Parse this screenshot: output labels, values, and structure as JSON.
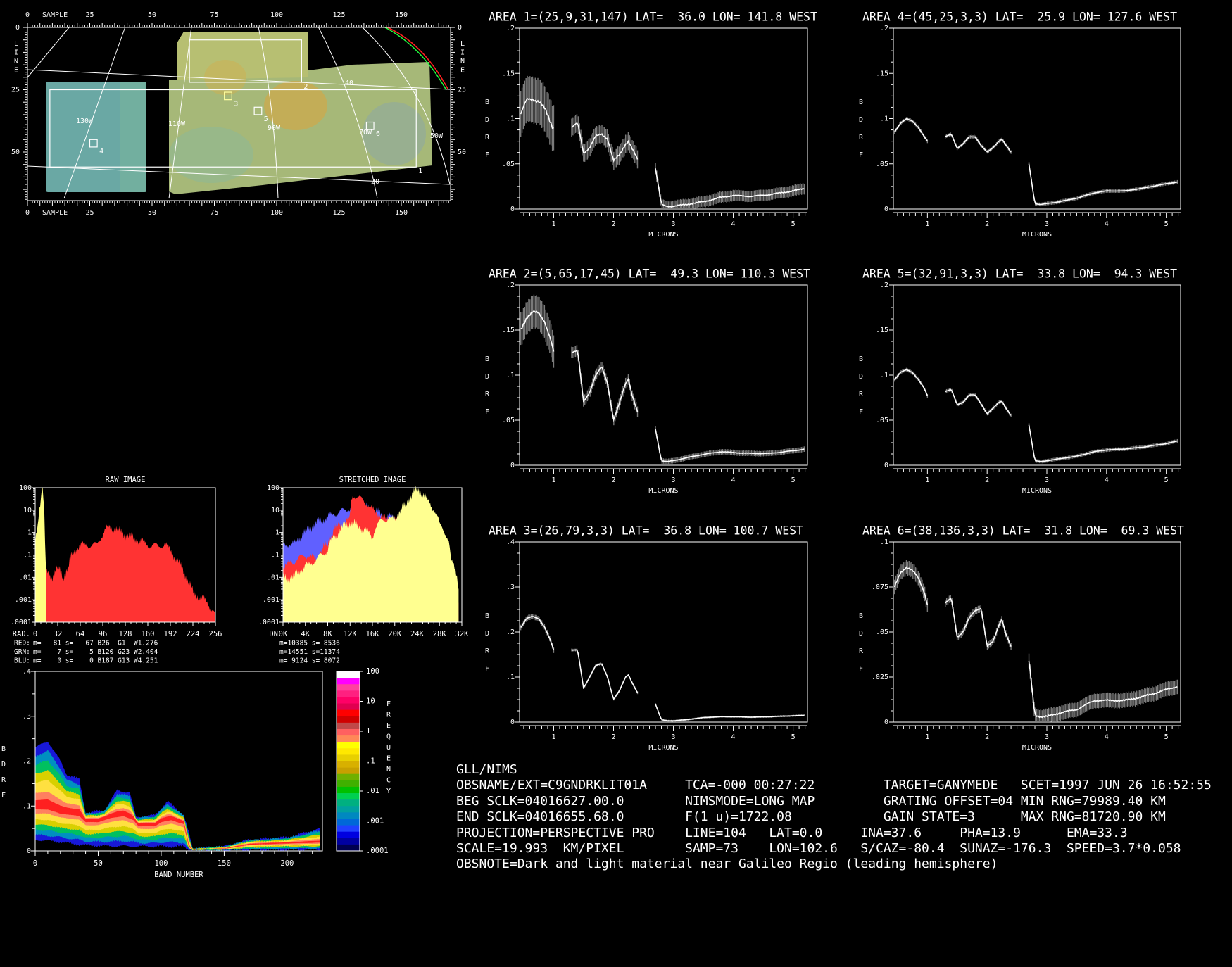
{
  "map": {
    "sample_axis_label": "SAMPLE",
    "line_axis_label": "LINE",
    "sample_ticks": [
      "0",
      "25",
      "50",
      "75",
      "100",
      "125",
      "150"
    ],
    "line_ticks": [
      "0",
      "25",
      "50"
    ],
    "lat_labels": [
      "40",
      "20"
    ],
    "lon_labels": [
      "130W",
      "110W",
      "90W",
      "70W",
      "50W"
    ],
    "areas": [
      {
        "id": "1",
        "line": 25,
        "sample": 9,
        "nl": 31,
        "ns": 147
      },
      {
        "id": "2",
        "line": 5,
        "sample": 65,
        "nl": 17,
        "ns": 45
      },
      {
        "id": "3",
        "line": 26,
        "sample": 79,
        "nl": 3,
        "ns": 3
      },
      {
        "id": "4",
        "line": 45,
        "sample": 25,
        "nl": 3,
        "ns": 3
      },
      {
        "id": "5",
        "line": 32,
        "sample": 91,
        "nl": 3,
        "ns": 3
      },
      {
        "id": "6",
        "line": 38,
        "sample": 136,
        "nl": 3,
        "ns": 3
      }
    ]
  },
  "spectra": {
    "x_label": "MICRONS",
    "y_label_letters": [
      "B",
      "D",
      "R",
      "F"
    ],
    "x_ticks": [
      "1",
      "2",
      "3",
      "4",
      "5"
    ],
    "wavelengths": [
      0.45,
      0.55,
      0.65,
      0.75,
      0.85,
      0.95,
      1.0,
      null,
      1.3,
      1.4,
      1.5,
      1.6,
      1.7,
      1.8,
      1.9,
      2.0,
      2.1,
      2.2,
      2.25,
      2.3,
      2.4,
      null,
      2.7,
      2.8,
      2.9,
      3.0,
      3.2,
      3.5,
      3.8,
      4.0,
      4.3,
      4.6,
      5.0,
      5.2
    ],
    "areas": [
      {
        "title": "AREA 1=(25,9,31,147) LAT=  36.0 LON= 141.8 WEST",
        "ymax": 0.2,
        "y_ticks": [
          "0",
          ".05",
          ".1",
          ".15",
          ".2"
        ],
        "bdrf": [
          0.105,
          0.12,
          0.122,
          0.12,
          0.11,
          0.095,
          0.09,
          null,
          0.09,
          0.095,
          0.062,
          0.068,
          0.08,
          0.083,
          0.078,
          0.053,
          0.06,
          0.072,
          0.075,
          0.068,
          0.055,
          null,
          0.045,
          0.005,
          0.003,
          0.003,
          0.005,
          0.008,
          0.013,
          0.015,
          0.014,
          0.016,
          0.02,
          0.023
        ],
        "error": [
          0.025,
          0.01,
          0.006
        ]
      },
      {
        "title": "AREA 2=(5,65,17,45) LAT=  49.3 LON= 110.3 WEST",
        "ymax": 0.2,
        "y_ticks": [
          "0",
          ".05",
          ".1",
          ".15",
          ".2"
        ],
        "bdrf": [
          0.15,
          0.165,
          0.17,
          0.168,
          0.16,
          0.14,
          0.125,
          null,
          0.125,
          0.128,
          0.07,
          0.08,
          0.1,
          0.11,
          0.09,
          0.05,
          0.07,
          0.09,
          0.095,
          0.08,
          0.06,
          null,
          0.04,
          0.005,
          0.004,
          0.005,
          0.008,
          0.012,
          0.015,
          0.014,
          0.013,
          0.013,
          0.016,
          0.018
        ],
        "error": [
          0.018,
          0.006,
          0.003
        ]
      },
      {
        "title": "AREA 3=(26,79,3,3) LAT=  36.8 LON= 100.7 WEST",
        "ymax": 0.4,
        "y_ticks": [
          "0",
          ".1",
          ".2",
          ".3",
          ".4"
        ],
        "bdrf": [
          0.21,
          0.23,
          0.235,
          0.23,
          0.21,
          0.18,
          0.16,
          null,
          0.16,
          0.16,
          0.075,
          0.1,
          0.125,
          0.13,
          0.1,
          0.05,
          0.07,
          0.1,
          0.105,
          0.09,
          0.065,
          null,
          0.04,
          0.005,
          0.003,
          0.003,
          0.005,
          0.01,
          0.012,
          0.012,
          0.011,
          0.012,
          0.014,
          0.015
        ],
        "error": [
          0.006,
          0.003,
          0.002
        ]
      },
      {
        "title": "AREA 4=(45,25,3,3) LAT=  25.9 LON= 127.6 WEST",
        "ymax": 0.2,
        "y_ticks": [
          "0",
          ".05",
          ".1",
          ".15",
          ".2"
        ],
        "bdrf": [
          0.085,
          0.095,
          0.1,
          0.097,
          0.09,
          0.08,
          0.075,
          null,
          0.08,
          0.083,
          0.067,
          0.072,
          0.08,
          0.08,
          0.07,
          0.063,
          0.068,
          0.075,
          0.077,
          0.072,
          0.063,
          null,
          0.05,
          0.006,
          0.005,
          0.006,
          0.008,
          0.012,
          0.018,
          0.02,
          0.02,
          0.023,
          0.028,
          0.03
        ],
        "error": [
          0.002,
          0.002,
          0.002
        ]
      },
      {
        "title": "AREA 5=(32,91,3,3) LAT=  33.8 LON=  94.3 WEST",
        "ymax": 0.2,
        "y_ticks": [
          "0",
          ".05",
          ".1",
          ".15",
          ".2"
        ],
        "bdrf": [
          0.095,
          0.103,
          0.106,
          0.103,
          0.095,
          0.085,
          0.077,
          null,
          0.082,
          0.084,
          0.067,
          0.07,
          0.078,
          0.078,
          0.068,
          0.057,
          0.063,
          0.07,
          0.071,
          0.065,
          0.055,
          null,
          0.045,
          0.005,
          0.004,
          0.005,
          0.007,
          0.01,
          0.015,
          0.017,
          0.018,
          0.02,
          0.024,
          0.027
        ],
        "error": [
          0.002,
          0.002,
          0.002
        ]
      },
      {
        "title": "AREA 6=(38,136,3,3) LAT=  31.8 LON=  69.3 WEST",
        "ymax": 0.1,
        "y_ticks": [
          "0",
          ".025",
          ".05",
          ".075",
          ".1"
        ],
        "bdrf": [
          0.075,
          0.083,
          0.086,
          0.084,
          0.08,
          0.072,
          0.065,
          null,
          0.066,
          0.069,
          0.047,
          0.05,
          0.058,
          0.062,
          0.063,
          0.042,
          0.045,
          0.054,
          0.057,
          0.05,
          0.042,
          null,
          0.034,
          0.004,
          0.003,
          0.003,
          0.005,
          0.007,
          0.012,
          0.012,
          0.012,
          0.014,
          0.018,
          0.02
        ],
        "error": [
          0.004,
          0.002,
          0.004
        ]
      }
    ]
  },
  "histograms": {
    "y_ticks": [
      "100",
      "10",
      "1",
      ".1",
      ".01",
      ".001",
      ".0001"
    ],
    "raw": {
      "title": "RAW IMAGE",
      "axis_prefix": "RAD.",
      "x_ticks": [
        "0",
        "32",
        "64",
        "96",
        "128",
        "160",
        "192",
        "224",
        "256"
      ],
      "xmax": 256,
      "series": [
        {
          "name": "red",
          "color": "#ff3333",
          "points": [
            [
              0,
              0.01
            ],
            [
              8,
              0.02
            ],
            [
              16,
              0.016
            ],
            [
              24,
              0.01
            ],
            [
              32,
              0.025
            ],
            [
              40,
              0.01
            ],
            [
              48,
              0.03
            ],
            [
              56,
              0.16
            ],
            [
              64,
              0.25
            ],
            [
              72,
              0.3
            ],
            [
              80,
              0.25
            ],
            [
              88,
              0.3
            ],
            [
              96,
              0.8
            ],
            [
              104,
              1.8
            ],
            [
              112,
              1.6
            ],
            [
              120,
              1.1
            ],
            [
              128,
              0.8
            ],
            [
              136,
              0.6
            ],
            [
              144,
              0.5
            ],
            [
              160,
              0.28
            ],
            [
              176,
              0.25
            ],
            [
              184,
              0.3
            ],
            [
              192,
              0.16
            ],
            [
              200,
              0.06
            ],
            [
              208,
              0.025
            ],
            [
              216,
              0.008
            ],
            [
              224,
              0.002
            ],
            [
              240,
              0.001
            ],
            [
              248,
              0.0005
            ],
            [
              256,
              0.0002
            ]
          ]
        },
        {
          "name": "yellow",
          "color": "#ffff80",
          "points": [
            [
              0,
              0.5
            ],
            [
              4,
              2
            ],
            [
              8,
              16
            ],
            [
              10,
              100
            ],
            [
              12,
              20
            ],
            [
              14,
              0.1
            ],
            [
              16,
              0.0001
            ]
          ]
        }
      ],
      "stats": [
        {
          "label": "RED:",
          "color": "#ff3030",
          "text": "m=   81 s=   67 B26  G1  W1.276"
        },
        {
          "label": "GRN:",
          "color": "#ffff60",
          "text": "m=    7 s=    5 B120 G23 W2.404"
        },
        {
          "label": "BLU:",
          "color": "#7070ff",
          "text": "m=    0 s=    0 B187 G13 W4.251"
        }
      ]
    },
    "stretched": {
      "title": "STRETCHED IMAGE",
      "axis_prefix": "DN",
      "x_ticks": [
        "0K",
        "4K",
        "8K",
        "12K",
        "16K",
        "20K",
        "24K",
        "28K",
        "32K"
      ],
      "xmax": 32,
      "series": [
        {
          "name": "blue",
          "color": "#6060ff",
          "points": [
            [
              0,
              0.3
            ],
            [
              2,
              0.3
            ],
            [
              4,
              1
            ],
            [
              6,
              2.5
            ],
            [
              8,
              5
            ],
            [
              10,
              8
            ],
            [
              12,
              12
            ],
            [
              14,
              16
            ],
            [
              16,
              10
            ],
            [
              18,
              5
            ],
            [
              20,
              5
            ],
            [
              22,
              3
            ],
            [
              23,
              1
            ],
            [
              24,
              0.1
            ],
            [
              26,
              0.016
            ],
            [
              28,
              0.003
            ],
            [
              30,
              0.0006
            ],
            [
              31.5,
              0.0003
            ]
          ]
        },
        {
          "name": "red",
          "color": "#ff3333",
          "points": [
            [
              0,
              0.03
            ],
            [
              2,
              0.05
            ],
            [
              4,
              0.1
            ],
            [
              6,
              0.06
            ],
            [
              8,
              0.3
            ],
            [
              10,
              2
            ],
            [
              12,
              4
            ],
            [
              12.5,
              50
            ],
            [
              14,
              30
            ],
            [
              16,
              10
            ],
            [
              18,
              4
            ],
            [
              20,
              4
            ],
            [
              22,
              3
            ],
            [
              24,
              1.6
            ],
            [
              26,
              0.3
            ],
            [
              28,
              0.03
            ],
            [
              30,
              0.003
            ],
            [
              31.5,
              0.0003
            ]
          ]
        },
        {
          "name": "yellow",
          "color": "#ffff90",
          "points": [
            [
              0,
              0.01
            ],
            [
              2,
              0.01
            ],
            [
              4,
              0.03
            ],
            [
              6,
              0.06
            ],
            [
              8,
              0.16
            ],
            [
              10,
              1
            ],
            [
              12,
              3
            ],
            [
              14,
              1.6
            ],
            [
              16,
              0.6
            ],
            [
              18,
              4
            ],
            [
              20,
              4
            ],
            [
              22,
              16
            ],
            [
              24,
              80
            ],
            [
              25,
              60
            ],
            [
              26,
              20
            ],
            [
              28,
              2
            ],
            [
              30,
              0.05
            ],
            [
              31.5,
              0.0003
            ]
          ]
        }
      ],
      "stats": [
        "m=10385 s= 8536",
        "m=14551 s=11374",
        "m= 9124 s= 8072"
      ]
    }
  },
  "band_plot": {
    "x_label": "BAND NUMBER",
    "y_label_letters": [
      "B",
      "D",
      "R",
      "F"
    ],
    "x_ticks": [
      "0",
      "50",
      "100",
      "150",
      "200"
    ],
    "y_ticks": [
      "0",
      ".1",
      ".2",
      ".3",
      ".4"
    ],
    "xmax": 228,
    "ymax": 0.4,
    "mean": [
      [
        0,
        0.1
      ],
      [
        10,
        0.1
      ],
      [
        20,
        0.09
      ],
      [
        35,
        0.085
      ],
      [
        40,
        0.07
      ],
      [
        50,
        0.07
      ],
      [
        60,
        0.08
      ],
      [
        70,
        0.085
      ],
      [
        78,
        0.075
      ],
      [
        82,
        0.06
      ],
      [
        95,
        0.06
      ],
      [
        100,
        0.07
      ],
      [
        108,
        0.075
      ],
      [
        118,
        0.065
      ],
      [
        122,
        0.01
      ],
      [
        125,
        0.003
      ],
      [
        150,
        0.005
      ],
      [
        170,
        0.015
      ],
      [
        200,
        0.018
      ],
      [
        226,
        0.02
      ]
    ],
    "upper": [
      [
        0,
        0.23
      ],
      [
        10,
        0.245
      ],
      [
        20,
        0.2
      ],
      [
        25,
        0.17
      ],
      [
        35,
        0.16
      ],
      [
        40,
        0.085
      ],
      [
        55,
        0.09
      ],
      [
        65,
        0.135
      ],
      [
        75,
        0.13
      ],
      [
        80,
        0.075
      ],
      [
        95,
        0.08
      ],
      [
        105,
        0.11
      ],
      [
        118,
        0.08
      ],
      [
        122,
        0.04
      ],
      [
        125,
        0.005
      ],
      [
        150,
        0.01
      ],
      [
        170,
        0.025
      ],
      [
        200,
        0.03
      ],
      [
        226,
        0.05
      ]
    ],
    "lower": [
      [
        0,
        0.025
      ],
      [
        20,
        0.02
      ],
      [
        40,
        0.012
      ],
      [
        80,
        0.01
      ],
      [
        100,
        0.01
      ],
      [
        118,
        0.01
      ],
      [
        122,
        0.003
      ],
      [
        150,
        0.002
      ],
      [
        226,
        0.003
      ]
    ],
    "colorbar_label_letters": [
      "F",
      "R",
      "E",
      "Q",
      "U",
      "E",
      "N",
      "C",
      "Y"
    ],
    "colorbar_ticks": [
      "100",
      "10",
      "1",
      ".1",
      ".01",
      ".001",
      ".0001"
    ],
    "colorbar_colors": [
      "#ffffff",
      "#ff00ff",
      "#ff40a0",
      "#ff2080",
      "#ff0066",
      "#e00050",
      "#ff0000",
      "#d00000",
      "#c04848",
      "#ff6060",
      "#ff8858",
      "#ffff00",
      "#ffe800",
      "#e8d000",
      "#d8b000",
      "#c8a000",
      "#70b000",
      "#40b000",
      "#00c000",
      "#00d050",
      "#00b080",
      "#00a0a0",
      "#0088c0",
      "#0068d8",
      "#2040ff",
      "#0000e0",
      "#0000a0",
      "#000050"
    ],
    "layer_colors": [
      "#1818d8",
      "#0090c0",
      "#00c060",
      "#d8d000",
      "#ffe040",
      "#ff8060",
      "#ff2020"
    ]
  },
  "info": {
    "title": "GLL/NIMS",
    "rows": [
      [
        "OBSNAME/EXT=C9GNDRKLIT01A",
        "TCA=-000 00:27:22",
        "TARGET=GANYMEDE",
        "SCET=1997 JUN 26 16:52:55"
      ],
      [
        "BEG SCLK=04016627.00.0",
        "NIMSMODE=LONG MAP",
        "GRATING OFFSET=04 MIN RNG=79989.40 KM"
      ],
      [
        "END SCLK=04016655.68.0",
        "F(1 u)=1722.08",
        "GAIN STATE=3",
        "MAX RNG=81720.90 KM"
      ],
      [
        "PROJECTION=PERSPECTIVE PRO",
        "LINE=104",
        "LAT=0.0",
        "INA=37.6",
        "PHA=13.9",
        "EMA=33.3"
      ],
      [
        "SCALE=19.993  KM/PIXEL",
        "SAMP=73",
        "LON=102.6",
        "S/CAZ=-80.4",
        "SUNAZ=-176.3",
        "SPEED=3.7*0.058"
      ]
    ],
    "obsnote": "OBSNOTE=Dark and light material near Galileo Regio (leading hemisphere)"
  },
  "colors": {
    "background": "#000000",
    "foreground": "#ffffff",
    "error_bar": "#7a7a7a"
  }
}
